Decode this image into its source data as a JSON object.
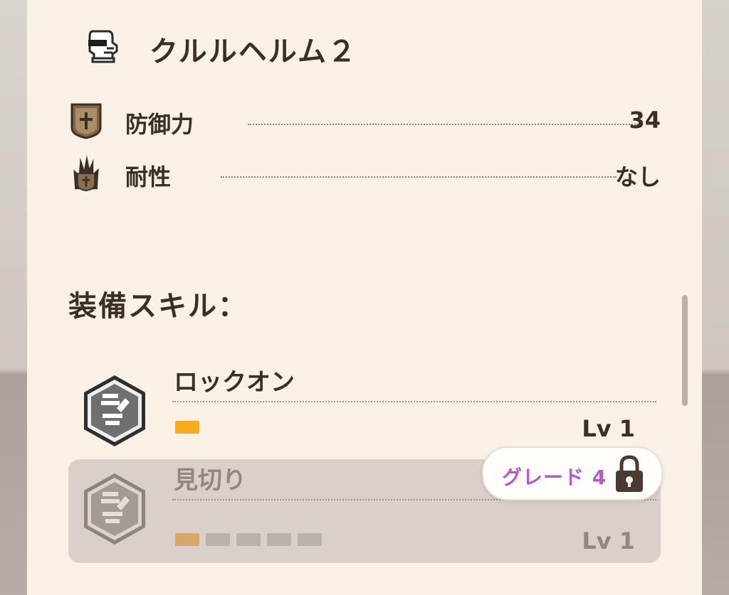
{
  "item": {
    "icon": "helmet-icon",
    "title": "クルルヘルム２"
  },
  "stats": [
    {
      "icon": "shield-icon",
      "label": "防御力",
      "value": "34"
    },
    {
      "icon": "fire-resistance-icon",
      "label": "耐性",
      "value": "なし"
    }
  ],
  "skills_section": {
    "title": "装備スキル：",
    "skills": [
      {
        "icon": "lock-on-skill-icon",
        "name": "ロックオン",
        "level": "Lv 1",
        "level_value": 1,
        "max_level": 1,
        "locked": false
      },
      {
        "icon": "lock-on-skill-icon",
        "name": "見切り",
        "level": "Lv 1",
        "level_value": 1,
        "max_level": 5,
        "locked": true,
        "unlock_badge": {
          "text": "グレード 4",
          "icon": "padlock-icon"
        }
      }
    ]
  },
  "colors": {
    "panel_bg": "#faf1e6",
    "text": "#3a2e26",
    "pip_active": "#f6ac1d",
    "pip_inactive": "#b8b2ad",
    "grade_text": "#b25ac9",
    "locked_row_bg": "#d9d1c9"
  }
}
